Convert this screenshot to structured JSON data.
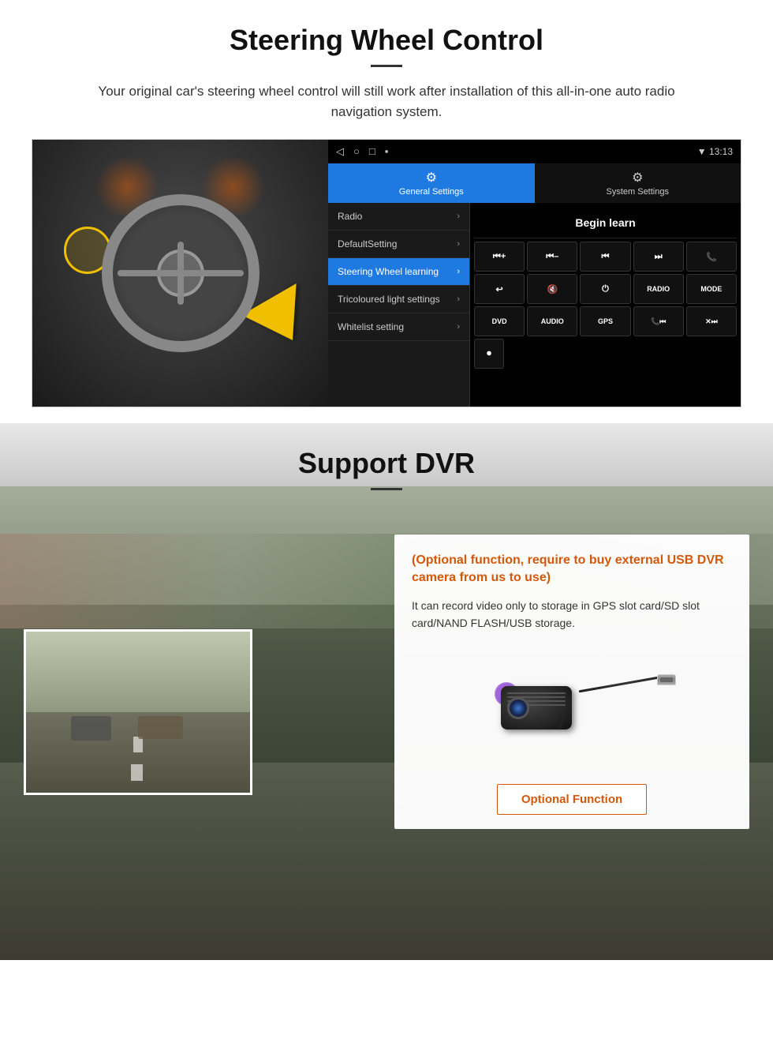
{
  "section1": {
    "title": "Steering Wheel Control",
    "subtitle": "Your original car's steering wheel control will still work after installation of this all-in-one auto radio navigation system.",
    "statusbar": {
      "nav_icons": [
        "◁",
        "○",
        "□",
        "▪"
      ],
      "time": "13:13",
      "signal_icons": [
        "signal",
        "wifi"
      ]
    },
    "tabs": {
      "general": {
        "label": "General Settings",
        "icon": "⚙"
      },
      "system": {
        "label": "System Settings",
        "icon": "🔧"
      }
    },
    "menu_items": [
      {
        "label": "Radio",
        "active": false
      },
      {
        "label": "DefaultSetting",
        "active": false
      },
      {
        "label": "Steering Wheel learning",
        "active": true
      },
      {
        "label": "Tricoloured light settings",
        "active": false
      },
      {
        "label": "Whitelist setting",
        "active": false
      }
    ],
    "begin_learn": "Begin learn",
    "control_buttons": [
      "⏮+",
      "⏮–",
      "⏮⏮",
      "⏭⏭",
      "📞",
      "↩",
      "🔇",
      "⏻",
      "RADIO",
      "MODE"
    ],
    "dvd_buttons": [
      "DVD",
      "AUDIO",
      "GPS",
      "📞⏮",
      "✕⏭"
    ],
    "extra_buttons": [
      "⏺"
    ]
  },
  "section2": {
    "title": "Support DVR",
    "optional_note": "(Optional function, require to buy external USB DVR camera from us to use)",
    "description": "It can record video only to storage in GPS slot card/SD slot card/NAND FLASH/USB storage.",
    "optional_function_button": "Optional Function"
  }
}
